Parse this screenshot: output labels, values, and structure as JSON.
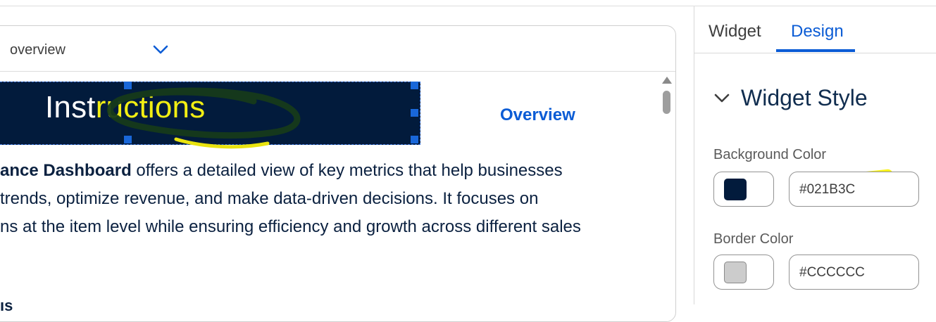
{
  "canvas": {
    "dropdown": {
      "value": "overview"
    },
    "banner": {
      "title_plain": "Inst",
      "title_highlight": "ructions"
    },
    "overview_link": "Overview",
    "body": {
      "line1_bold": "ance Dashboard",
      "line1_rest": " offers a detailed view of key metrics that help businesses",
      "line2": "trends, optimize revenue, and make data-driven decisions. It focuses on",
      "line3": "ns at the item level while ensuring efficiency and growth across different sales"
    },
    "bottom_fragment": "ıs"
  },
  "panel": {
    "tabs": [
      {
        "label": "Widget",
        "active": false
      },
      {
        "label": "Design",
        "active": true
      }
    ],
    "section": {
      "title": "Widget Style"
    },
    "background_color": {
      "label": "Background Color",
      "value": "#021B3C",
      "swatch": "#021b3c"
    },
    "border_color": {
      "label": "Border Color",
      "value": "#CCCCCC",
      "swatch": "#cccccc"
    }
  },
  "colors": {
    "accent": "#0b5cd5",
    "banner_bg": "#021b3c",
    "highlight": "#f8f10f"
  }
}
